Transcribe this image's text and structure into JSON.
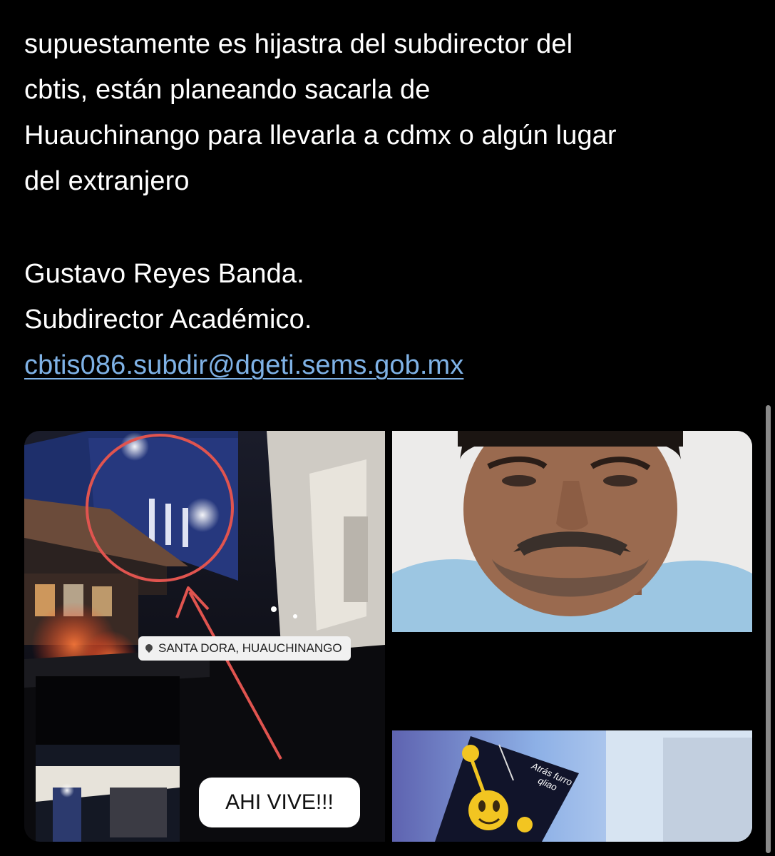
{
  "tweet": {
    "lines": [
      "supuestamente es hijastra del subdirector del",
      "cbtis, están planeando sacarla de",
      "Huauchinango para llevarla a cdmx o algún lugar",
      "del extranjero"
    ],
    "signature": [
      "Gustavo Reyes Banda.",
      "Subdirector Académico."
    ],
    "email_link": "cbtis086.subdir@dgeti.sems.gob.mx"
  },
  "media": {
    "street_photo": {
      "location_tag": "SANTA DORA, HUAUCHINANGO",
      "caption": "AHI VIVE!!!",
      "pin_icon": "location-pin-icon"
    },
    "meme_photo": {
      "meme_text": "Atrás furro qliao"
    }
  },
  "colors": {
    "background": "#000000",
    "text": "#ffffff",
    "link": "#7fb2e6",
    "annotation_red": "#e0544f"
  }
}
